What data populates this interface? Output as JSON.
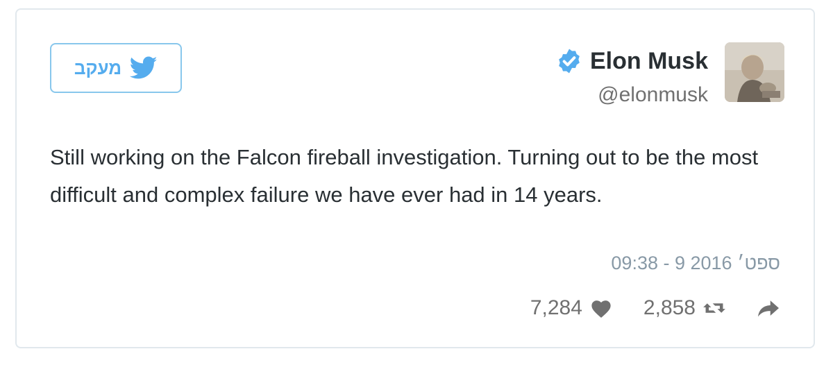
{
  "follow_button": {
    "label": "מעקב",
    "icon": "twitter-bird-icon"
  },
  "user": {
    "display_name": "Elon Musk",
    "handle": "@elonmusk",
    "verified_icon": "verified-badge-icon",
    "avatar_icon": "profile-photo"
  },
  "tweet": {
    "text": "Still working on the Falcon fireball investigation. Turning out to be the most difficult and complex failure we have ever had in 14 years.",
    "timestamp": "09:38 - 9 ספט׳ 2016"
  },
  "actions": {
    "likes": "7,284",
    "retweets": "2,858",
    "like_icon": "heart-icon",
    "retweet_icon": "retweet-icon",
    "share_icon": "share-arrow-icon"
  },
  "colors": {
    "accent": "#55acee",
    "border": "#e1e8ed",
    "text": "#292f33",
    "muted": "#8899a6"
  }
}
